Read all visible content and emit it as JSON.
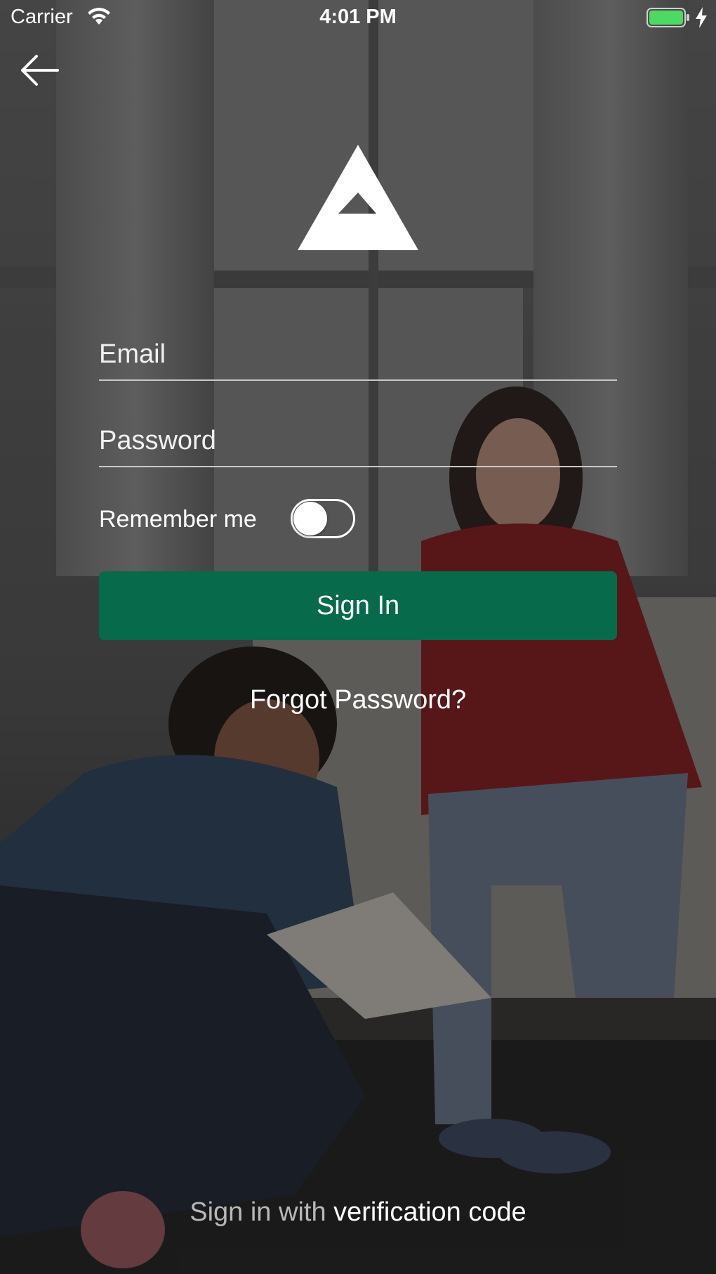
{
  "status_bar": {
    "carrier": "Carrier",
    "time": "4:01 PM",
    "wifi_icon": "wifi-icon",
    "battery_icon": "battery-icon",
    "charging_icon": "charging-bolt-icon",
    "battery_color": "#4cd964"
  },
  "nav": {
    "back_icon": "arrow-left-icon"
  },
  "logo": {
    "icon": "triangle-logo"
  },
  "form": {
    "email_placeholder": "Email",
    "email_value": "",
    "password_placeholder": "Password",
    "password_value": "",
    "remember_label": "Remember me",
    "remember_on": false,
    "signin_label": "Sign In",
    "forgot_label": "Forgot Password?"
  },
  "footer": {
    "verification_prefix": "Sign in with",
    "verification_link": "verification code"
  },
  "colors": {
    "primary_button": "#076a4a",
    "text": "#ffffff",
    "muted_text": "#b8b8b8"
  }
}
